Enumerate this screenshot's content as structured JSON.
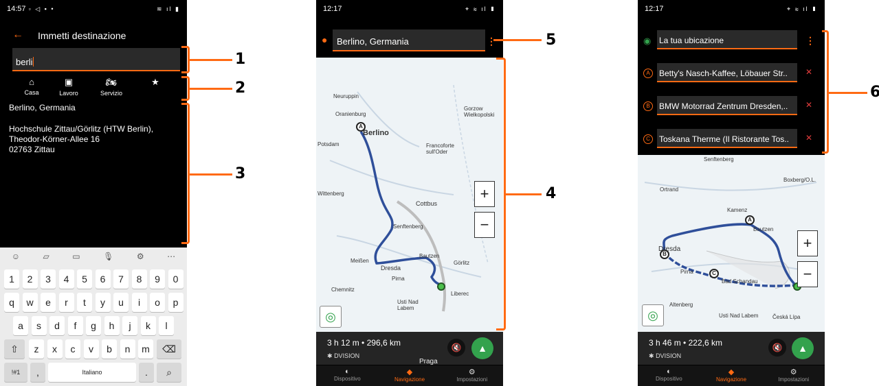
{
  "colors": {
    "accent": "#ff6a13",
    "go": "#33a24d",
    "route": "#2f4f9a",
    "delete": "#e03c3c"
  },
  "phone1": {
    "status": {
      "time": "14:57"
    },
    "header": {
      "title": "Immetti destinazione"
    },
    "search": {
      "value": "berli"
    },
    "favorites": [
      {
        "icon": "home-icon",
        "label": "Casa"
      },
      {
        "icon": "briefcase-icon",
        "label": "Lavoro"
      },
      {
        "icon": "motorcycle-icon",
        "label": "Servizio"
      },
      {
        "icon": "star-icon",
        "label": ""
      }
    ],
    "results": [
      {
        "lines": [
          "Berlino, Germania"
        ]
      },
      {
        "lines": [
          "Hochschule Zittau/Görlitz (HTW Berlin),",
          "Theodor-Körner-Allee 16",
          "02763 Zittau"
        ]
      }
    ],
    "keyboard": {
      "row1": [
        "1",
        "2",
        "3",
        "4",
        "5",
        "6",
        "7",
        "8",
        "9",
        "0"
      ],
      "row2": [
        "q",
        "w",
        "e",
        "r",
        "t",
        "y",
        "u",
        "i",
        "o",
        "p"
      ],
      "row3": [
        "a",
        "s",
        "d",
        "f",
        "g",
        "h",
        "j",
        "k",
        "l"
      ],
      "row4": [
        "z",
        "x",
        "c",
        "v",
        "b",
        "n",
        "m"
      ],
      "symbols": "!#1",
      "comma": ",",
      "language": "Italiano",
      "period": "."
    }
  },
  "phone2": {
    "status": {
      "time": "12:17"
    },
    "destination": "Berlino, Germania",
    "map_labels": [
      "Neuruppin",
      "Oranienburg",
      "Gorzow Wielkopolski",
      "Berlino",
      "Potsdam",
      "Francoforte sull'Oder",
      "Wittenberg",
      "Cottbus",
      "Senftenberg",
      "Meißen",
      "Dresda",
      "Pirna",
      "Bautzen",
      "Görlitz",
      "Chemnitz",
      "Usti Nad Labem",
      "Liberec",
      "Praga"
    ],
    "route_info": {
      "time": "3 h 12 m",
      "sep": "•",
      "distance": "296,6 km"
    },
    "device": "DVISION",
    "nav": {
      "device": "Dispositivo",
      "navigation": "Navigazione",
      "settings": "Impostazioni"
    }
  },
  "phone3": {
    "status": {
      "time": "12:17"
    },
    "waypoints": [
      {
        "marker": "",
        "label": "La tua ubicazione"
      },
      {
        "marker": "A",
        "label": "Betty's Nasch-Kaffee, Löbauer Str.."
      },
      {
        "marker": "B",
        "label": "BMW Motorrad Zentrum Dresden,.."
      },
      {
        "marker": "C",
        "label": "Toskana Therme (Il Ristorante Tos.."
      }
    ],
    "map_labels": [
      "Senftenberg",
      "Ortrand",
      "Boxberg/O.L.",
      "Kamenz",
      "Bautzen",
      "Dresda",
      "Pirna",
      "Bad Schandau",
      "Altenberg",
      "Usti Nad Labem",
      "Česká Lípa"
    ],
    "route_info": {
      "time": "3 h 46 m",
      "sep": "•",
      "distance": "222,6 km"
    },
    "device": "DVISION",
    "nav": {
      "device": "Dispositivo",
      "navigation": "Navigazione",
      "settings": "Impostazioni"
    }
  },
  "callouts": [
    "1",
    "2",
    "3",
    "4",
    "5",
    "6"
  ]
}
